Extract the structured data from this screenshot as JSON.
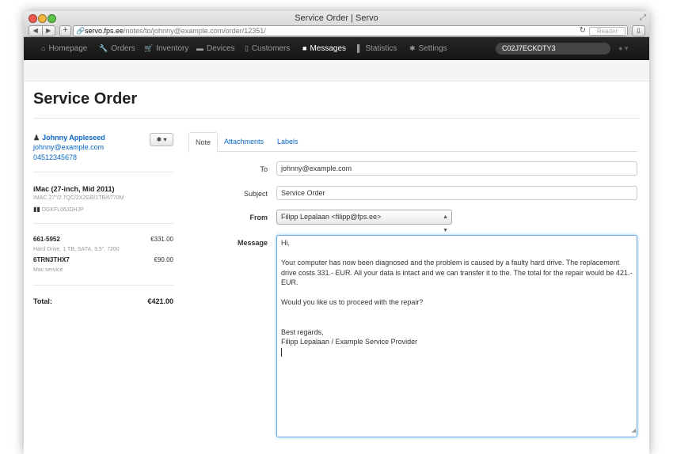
{
  "browser": {
    "window_title": "Service Order | Servo",
    "url_host": "servo.fps.ee",
    "url_path": "/notes/to/johnny@example.com/order/12351/",
    "reader_label": "Reader"
  },
  "nav": {
    "items": [
      {
        "label": "Homepage",
        "icon": "home-icon"
      },
      {
        "label": "Orders",
        "icon": "wrench-icon"
      },
      {
        "label": "Inventory",
        "icon": "cart-icon"
      },
      {
        "label": "Devices",
        "icon": "laptop-icon"
      },
      {
        "label": "Customers",
        "icon": "book-icon"
      },
      {
        "label": "Messages",
        "icon": "comment-icon",
        "active": true
      },
      {
        "label": "Statistics",
        "icon": "signal-icon"
      },
      {
        "label": "Settings",
        "icon": "gear-icon"
      }
    ],
    "search_value": "C02J7ECKDTY3"
  },
  "page": {
    "title": "Service Order"
  },
  "customer": {
    "name": "Johnny Appleseed",
    "email": "johnny@example.com",
    "phone": "04512345678"
  },
  "device": {
    "name": "iMac (27-inch, Mid 2011)",
    "spec": "IMAC 27\"/2.7QC/2X2GB/1TB/6770M",
    "serial": "DGKFL06JDHJP"
  },
  "order_lines": [
    {
      "code": "661-5952",
      "description": "Hard Drive, 1 TB, SATA, 3.5\", 7200",
      "price": "€331.00"
    },
    {
      "code": "6TRN3THX7",
      "description": "Mac service",
      "price": "€90.00"
    }
  ],
  "total": {
    "label": "Total:",
    "value": "€421.00"
  },
  "tabs": [
    {
      "label": "Note",
      "active": true
    },
    {
      "label": "Attachments"
    },
    {
      "label": "Labels"
    }
  ],
  "form": {
    "to_label": "To",
    "to_value": "johnny@example.com",
    "subject_label": "Subject",
    "subject_value": "Service Order",
    "from_label": "From",
    "from_value": "Filipp Lepalaan <filipp@fps.ee>",
    "message_label": "Message",
    "message_value": "Hi,\n\nYour computer has now been diagnosed and the problem is caused by a faulty hard drive. The replacement drive costs 331.- EUR. All your data is intact and we can transfer it to the. The total for the repair would be 421.- EUR.\n\nWould you like us to proceed with the repair?\n\n\nBest regards,\nFilipp Lepalaan / Example Service Provider"
  },
  "colors": {
    "link": "#0866c6",
    "navbar": "#1f1f1f",
    "focus_border": "#6fa9e8"
  }
}
